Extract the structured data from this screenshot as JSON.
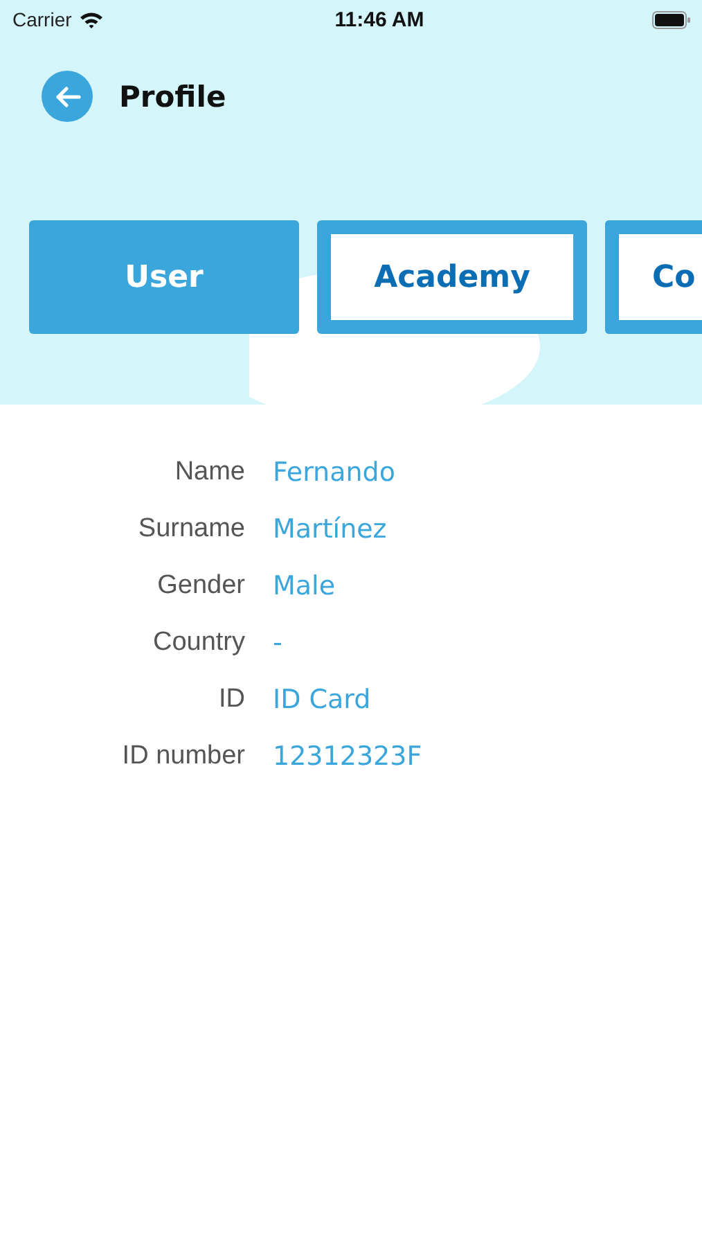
{
  "status_bar": {
    "carrier": "Carrier",
    "time": "11:46 AM"
  },
  "header": {
    "title": "Profile"
  },
  "tabs": [
    {
      "label": "User",
      "selected": true
    },
    {
      "label": "Academy",
      "selected": false
    },
    {
      "label": "Co",
      "selected": false
    }
  ],
  "fields": [
    {
      "label": "Name",
      "value": "Fernando"
    },
    {
      "label": "Surname",
      "value": "Martínez"
    },
    {
      "label": "Gender",
      "value": "Male"
    },
    {
      "label": "Country",
      "value": "-"
    },
    {
      "label": "ID",
      "value": "ID Card"
    },
    {
      "label": "ID number",
      "value": "12312323F"
    }
  ]
}
